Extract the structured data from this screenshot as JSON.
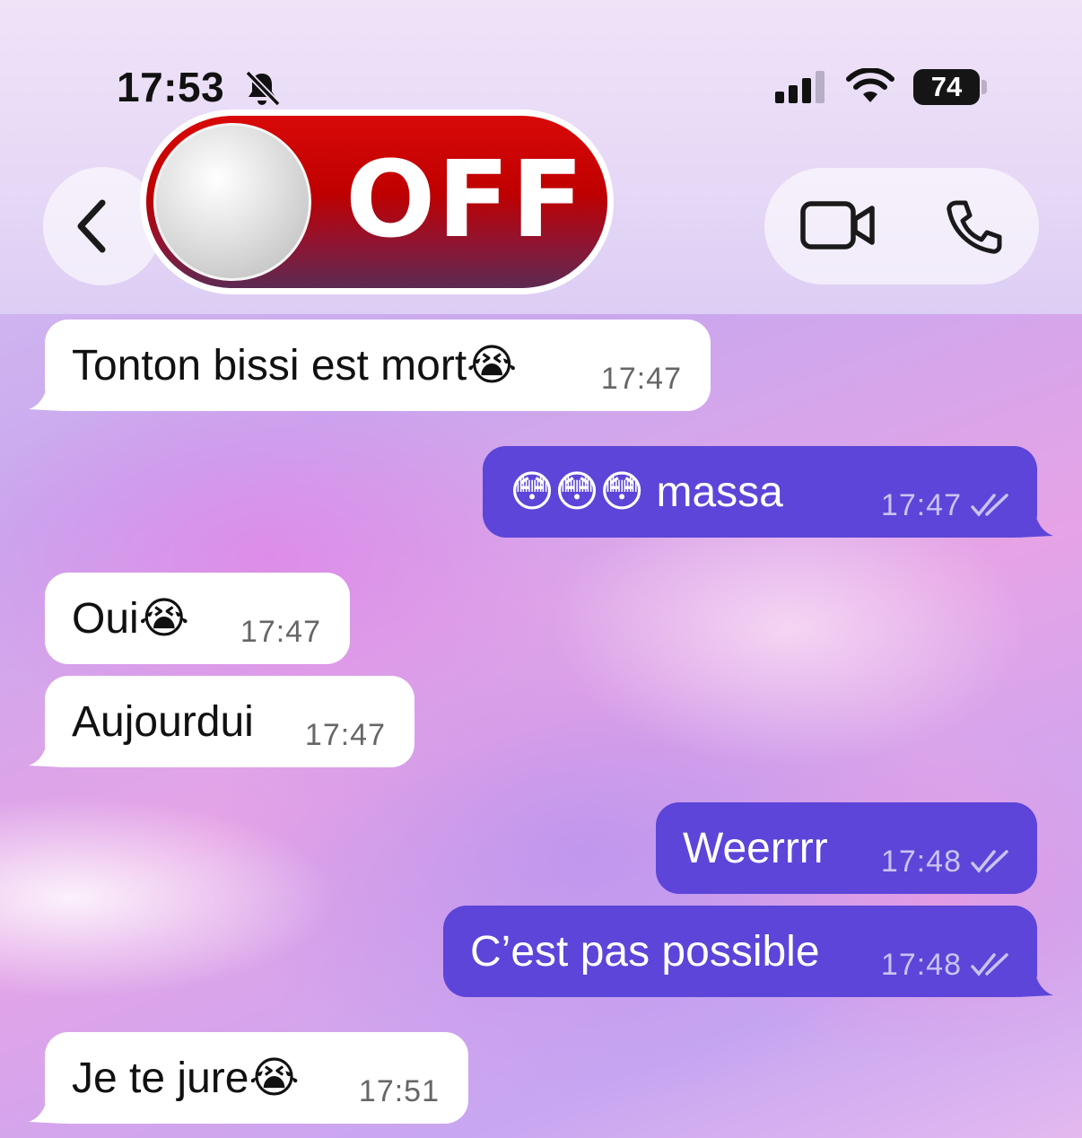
{
  "status_bar": {
    "time": "17:53",
    "battery": "74",
    "icons": [
      "bell-muted-icon",
      "cellular-signal-icon",
      "wifi-icon",
      "battery-icon"
    ]
  },
  "header": {
    "sticker_text": "OFF",
    "icons": [
      "back-chevron-icon",
      "video-call-icon",
      "phone-call-icon"
    ]
  },
  "colors": {
    "outgoing_bubble": "#5c45d8",
    "incoming_bubble": "#ffffff",
    "sticker_red": "#c80000"
  },
  "messages": [
    {
      "direction": "in",
      "text": "Tonton bissi est mort😭",
      "time": "17:47"
    },
    {
      "direction": "out",
      "text": "😳😳😳 massa",
      "time": "17:47",
      "status": "read"
    },
    {
      "direction": "in",
      "text": "Oui😭",
      "time": "17:47"
    },
    {
      "direction": "in",
      "text": "Aujourdui",
      "time": "17:47"
    },
    {
      "direction": "out",
      "text": "Weerrrr",
      "time": "17:48",
      "status": "read"
    },
    {
      "direction": "out",
      "text": "C’est pas possible",
      "time": "17:48",
      "status": "read"
    },
    {
      "direction": "in",
      "text": "Je te jure😭",
      "time": "17:51"
    }
  ]
}
